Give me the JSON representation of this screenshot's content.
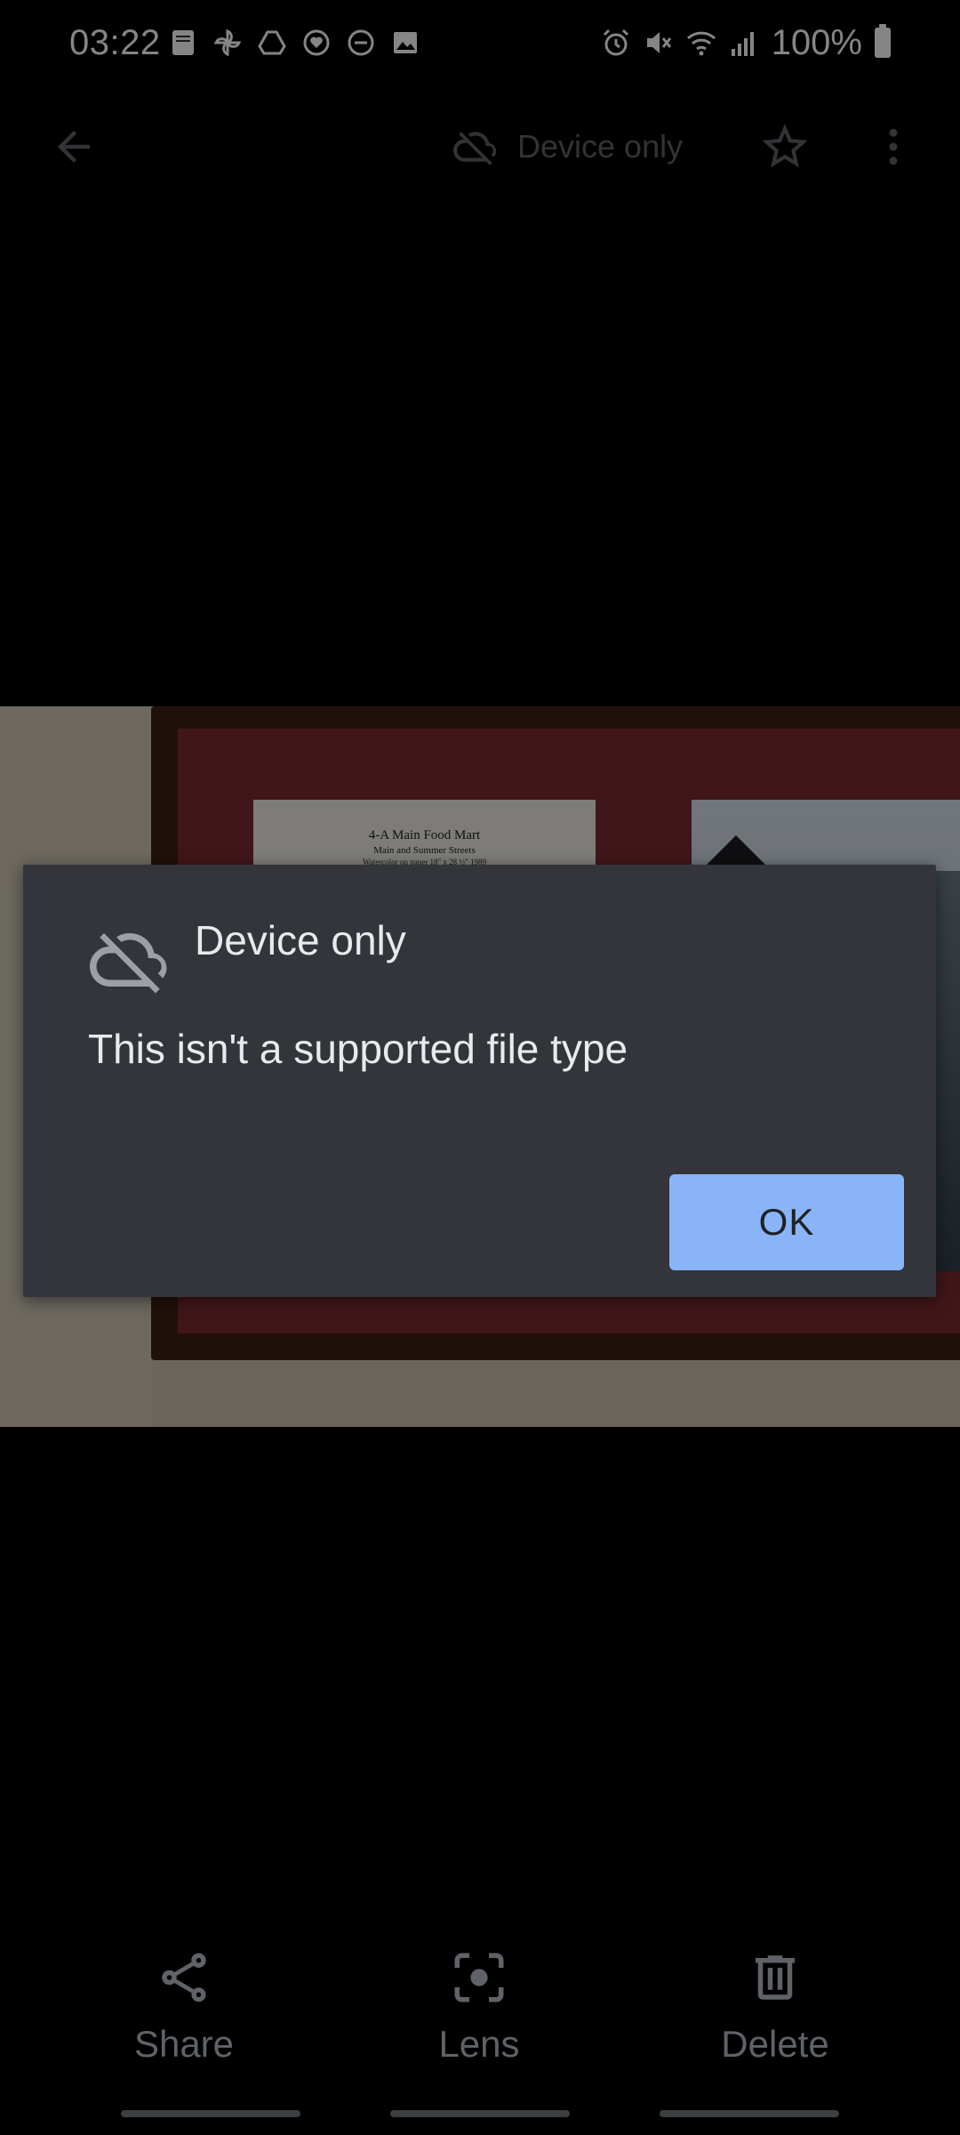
{
  "status_bar": {
    "time": "03:22",
    "left_icons": [
      "bible-app-icon",
      "pinwheel-icon",
      "drive-icon",
      "heart-icon",
      "dnd-icon",
      "gallery-icon"
    ],
    "right_icons": [
      "alarm-icon",
      "mute-icon",
      "wifi-icon",
      "signal-icon"
    ],
    "battery": "100%"
  },
  "top_bar": {
    "device_chip": "Device only",
    "icons": [
      "back-arrow-icon",
      "cloud-off-icon",
      "star-outline-icon",
      "more-vert-icon"
    ]
  },
  "photo": {
    "label_line1": "4-A  Main Food Mart",
    "label_line2": "Main and Summer Streets",
    "label_line3": "Watercolor on paper  18\" x 28 ½\"  1989"
  },
  "dialog": {
    "title": "Device only",
    "message": "This isn't a supported file type",
    "ok": "OK",
    "icon": "cloud-off-icon",
    "accent": "#8ab4f8",
    "background": "#33353b"
  },
  "bottom_actions": [
    {
      "label": "Share",
      "icon": "share-icon"
    },
    {
      "label": "Lens",
      "icon": "lens-icon"
    },
    {
      "label": "Delete",
      "icon": "trash-icon"
    }
  ]
}
